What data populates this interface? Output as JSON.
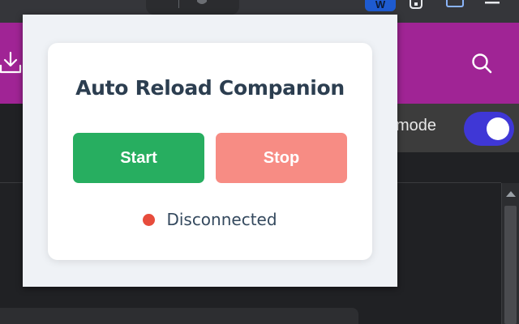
{
  "background": {
    "extension_badge": "W",
    "mode_label": "mode",
    "colors": {
      "header": "#a02495",
      "toggle": "#3f37d6"
    }
  },
  "popup": {
    "title": "Auto Reload Companion",
    "start_label": "Start",
    "stop_label": "Stop",
    "status_text": "Disconnected",
    "colors": {
      "start": "#27ae60",
      "stop": "#f78c84",
      "status_dot": "#e74c3c",
      "title": "#2c3e50"
    }
  },
  "icons": [
    "download-icon",
    "search-icon",
    "puzzle-icon",
    "side-panel-icon",
    "menu-icon",
    "shield-icon"
  ]
}
